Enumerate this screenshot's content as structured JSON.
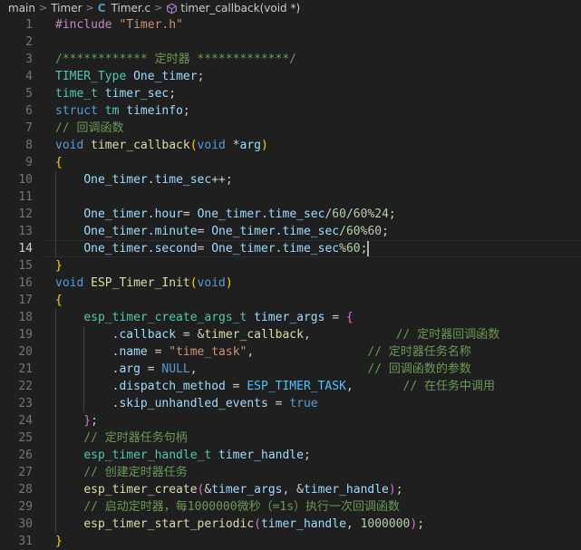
{
  "breadcrumb": {
    "items": [
      "main",
      "Timer"
    ],
    "file_icon": "C",
    "file": "Timer.c",
    "symbol": "timer_callback(void *)",
    "symbol_icon": "method-icon"
  },
  "colors": {
    "background": "#1f1f1f",
    "default": "#cccccc",
    "keyword": "#569cd6",
    "control": "#c586c0",
    "type": "#4ec9b0",
    "function": "#dcdcaa",
    "variable": "#9cdcfe",
    "string": "#ce9178",
    "number": "#b5cea8",
    "comment": "#6a9955",
    "constant": "#4fc1ff",
    "bracket_gold": "#ffd700",
    "bracket_pink": "#da70d6",
    "line_number": "#6e7681"
  },
  "editor": {
    "current_line": 14,
    "lines": [
      {
        "n": "1",
        "t": [
          [
            "#include",
            "control"
          ],
          [
            " ",
            "default"
          ],
          [
            "\"Timer.h\"",
            "string"
          ]
        ]
      },
      {
        "n": "2",
        "t": []
      },
      {
        "n": "3",
        "t": [
          [
            "/************ 定时器 *************/",
            "comment"
          ]
        ]
      },
      {
        "n": "4",
        "t": [
          [
            "TIMER_Type",
            "type"
          ],
          [
            " ",
            "default"
          ],
          [
            "One_timer",
            "variable"
          ],
          [
            ";",
            "default"
          ]
        ]
      },
      {
        "n": "5",
        "t": [
          [
            "time_t",
            "type"
          ],
          [
            " ",
            "default"
          ],
          [
            "timer_sec",
            "variable"
          ],
          [
            ";",
            "default"
          ]
        ]
      },
      {
        "n": "6",
        "t": [
          [
            "struct",
            "keyword"
          ],
          [
            " ",
            "default"
          ],
          [
            "tm",
            "type"
          ],
          [
            " ",
            "default"
          ],
          [
            "timeinfo",
            "variable"
          ],
          [
            ";",
            "default"
          ]
        ]
      },
      {
        "n": "7",
        "t": [
          [
            "// 回调函数",
            "comment"
          ]
        ]
      },
      {
        "n": "8",
        "t": [
          [
            "void",
            "keyword"
          ],
          [
            " ",
            "default"
          ],
          [
            "timer_callback",
            "function"
          ],
          [
            "(",
            "bracket_gold"
          ],
          [
            "void",
            "keyword"
          ],
          [
            " *",
            "default"
          ],
          [
            "arg",
            "variable"
          ],
          [
            ")",
            "bracket_gold"
          ]
        ]
      },
      {
        "n": "9",
        "t": [
          [
            "{",
            "bracket_gold"
          ]
        ]
      },
      {
        "n": "10",
        "t": [
          [
            "    ",
            "default"
          ],
          [
            "One_timer",
            "variable"
          ],
          [
            ".",
            "default"
          ],
          [
            "time_sec",
            "variable"
          ],
          [
            "++;",
            "default"
          ]
        ]
      },
      {
        "n": "11",
        "t": []
      },
      {
        "n": "12",
        "t": [
          [
            "    ",
            "default"
          ],
          [
            "One_timer",
            "variable"
          ],
          [
            ".",
            "default"
          ],
          [
            "hour",
            "variable"
          ],
          [
            "= ",
            "default"
          ],
          [
            "One_timer",
            "variable"
          ],
          [
            ".",
            "default"
          ],
          [
            "time_sec",
            "variable"
          ],
          [
            "/",
            "default"
          ],
          [
            "60",
            "number"
          ],
          [
            "/",
            "default"
          ],
          [
            "60",
            "number"
          ],
          [
            "%",
            "default"
          ],
          [
            "24",
            "number"
          ],
          [
            ";",
            "default"
          ]
        ]
      },
      {
        "n": "13",
        "t": [
          [
            "    ",
            "default"
          ],
          [
            "One_timer",
            "variable"
          ],
          [
            ".",
            "default"
          ],
          [
            "minute",
            "variable"
          ],
          [
            "= ",
            "default"
          ],
          [
            "One_timer",
            "variable"
          ],
          [
            ".",
            "default"
          ],
          [
            "time_sec",
            "variable"
          ],
          [
            "/",
            "default"
          ],
          [
            "60",
            "number"
          ],
          [
            "%",
            "default"
          ],
          [
            "60",
            "number"
          ],
          [
            ";",
            "default"
          ]
        ]
      },
      {
        "n": "14",
        "t": [
          [
            "    ",
            "default"
          ],
          [
            "One_timer",
            "variable"
          ],
          [
            ".",
            "default"
          ],
          [
            "second",
            "variable"
          ],
          [
            "= ",
            "default"
          ],
          [
            "One_timer",
            "variable"
          ],
          [
            ".",
            "default"
          ],
          [
            "time_sec",
            "variable"
          ],
          [
            "%",
            "default"
          ],
          [
            "60",
            "number"
          ],
          [
            ";",
            "default"
          ]
        ]
      },
      {
        "n": "15",
        "t": [
          [
            "}",
            "bracket_gold"
          ]
        ]
      },
      {
        "n": "16",
        "t": [
          [
            "void",
            "keyword"
          ],
          [
            " ",
            "default"
          ],
          [
            "ESP_Timer_Init",
            "function"
          ],
          [
            "(",
            "bracket_gold"
          ],
          [
            "void",
            "keyword"
          ],
          [
            ")",
            "bracket_gold"
          ]
        ]
      },
      {
        "n": "17",
        "t": [
          [
            "{",
            "bracket_gold"
          ]
        ]
      },
      {
        "n": "18",
        "t": [
          [
            "    ",
            "default"
          ],
          [
            "esp_timer_create_args_t",
            "type"
          ],
          [
            " ",
            "default"
          ],
          [
            "timer_args",
            "variable"
          ],
          [
            " = ",
            "default"
          ],
          [
            "{",
            "bracket_pink"
          ]
        ]
      },
      {
        "n": "19",
        "t": [
          [
            "        .",
            "default"
          ],
          [
            "callback",
            "variable"
          ],
          [
            " = &",
            "default"
          ],
          [
            "timer_callback",
            "function"
          ],
          [
            ",            ",
            "default"
          ],
          [
            "// 定时器回调函数",
            "comment"
          ]
        ]
      },
      {
        "n": "20",
        "t": [
          [
            "        .",
            "default"
          ],
          [
            "name",
            "variable"
          ],
          [
            " = ",
            "default"
          ],
          [
            "\"time_task\"",
            "string"
          ],
          [
            ",                ",
            "default"
          ],
          [
            "// 定时器任务名称",
            "comment"
          ]
        ]
      },
      {
        "n": "21",
        "t": [
          [
            "        .",
            "default"
          ],
          [
            "arg",
            "variable"
          ],
          [
            " = ",
            "default"
          ],
          [
            "NULL",
            "keyword"
          ],
          [
            ",                        ",
            "default"
          ],
          [
            "// 回调函数的参数",
            "comment"
          ]
        ]
      },
      {
        "n": "22",
        "t": [
          [
            "        .",
            "default"
          ],
          [
            "dispatch_method",
            "variable"
          ],
          [
            " = ",
            "default"
          ],
          [
            "ESP_TIMER_TASK",
            "constant"
          ],
          [
            ",       ",
            "default"
          ],
          [
            "// 在任务中调用",
            "comment"
          ]
        ]
      },
      {
        "n": "23",
        "t": [
          [
            "        .",
            "default"
          ],
          [
            "skip_unhandled_events",
            "variable"
          ],
          [
            " = ",
            "default"
          ],
          [
            "true",
            "keyword"
          ]
        ]
      },
      {
        "n": "24",
        "t": [
          [
            "    ",
            "default"
          ],
          [
            "}",
            "bracket_pink"
          ],
          [
            ";",
            "default"
          ]
        ]
      },
      {
        "n": "25",
        "t": [
          [
            "    ",
            "default"
          ],
          [
            "// 定时器任务句柄",
            "comment"
          ]
        ]
      },
      {
        "n": "26",
        "t": [
          [
            "    ",
            "default"
          ],
          [
            "esp_timer_handle_t",
            "type"
          ],
          [
            " ",
            "default"
          ],
          [
            "timer_handle",
            "variable"
          ],
          [
            ";",
            "default"
          ]
        ]
      },
      {
        "n": "27",
        "t": [
          [
            "    ",
            "default"
          ],
          [
            "// 创建定时器任务",
            "comment"
          ]
        ]
      },
      {
        "n": "28",
        "t": [
          [
            "    ",
            "default"
          ],
          [
            "esp_timer_create",
            "function"
          ],
          [
            "(",
            "bracket_pink"
          ],
          [
            "&",
            "default"
          ],
          [
            "timer_args",
            "variable"
          ],
          [
            ", &",
            "default"
          ],
          [
            "timer_handle",
            "variable"
          ],
          [
            ")",
            "bracket_pink"
          ],
          [
            ";",
            "default"
          ]
        ]
      },
      {
        "n": "29",
        "t": [
          [
            "    ",
            "default"
          ],
          [
            "// 启动定时器，每1000000微秒（=1s）执行一次回调函数",
            "comment"
          ]
        ]
      },
      {
        "n": "30",
        "t": [
          [
            "    ",
            "default"
          ],
          [
            "esp_timer_start_periodic",
            "function"
          ],
          [
            "(",
            "bracket_pink"
          ],
          [
            "timer_handle",
            "variable"
          ],
          [
            ", ",
            "default"
          ],
          [
            "1000000",
            "number"
          ],
          [
            ")",
            "bracket_pink"
          ],
          [
            ";",
            "default"
          ]
        ]
      },
      {
        "n": "31",
        "t": [
          [
            "}",
            "bracket_gold"
          ]
        ]
      }
    ]
  }
}
